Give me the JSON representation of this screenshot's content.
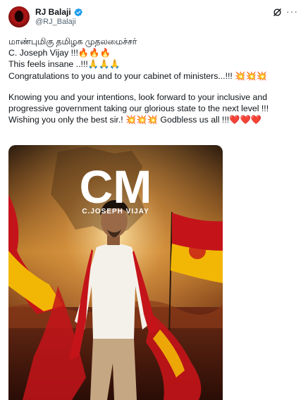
{
  "author": {
    "name": "RJ Balaji",
    "handle": "@RJ_Balaji",
    "verified": true
  },
  "post": {
    "lines1": [
      "மாண்புமிகு தமிழக முதலமைச்சர்",
      "C. Joseph Vijay !!!🔥🔥🔥",
      "This feels insane ..!!!🙏🙏🙏",
      "Congratulations to you and to your cabinet of ministers...!!! 💥💥💥"
    ],
    "lines2": [
      "Knowing you and your intentions, look forward to your inclusive and",
      "progressive government taking our glorious state to the next level !!!",
      "Wishing you only the best sir.! 💥💥💥 Godbless us all !!!❤️❤️❤️"
    ]
  },
  "poster": {
    "title": "CM",
    "subtitle": "C.JOSEPH VIJAY"
  },
  "colors": {
    "flag_red": "#c4141a",
    "flag_yellow": "#f2b705",
    "verified_blue": "#1d9bf0"
  }
}
